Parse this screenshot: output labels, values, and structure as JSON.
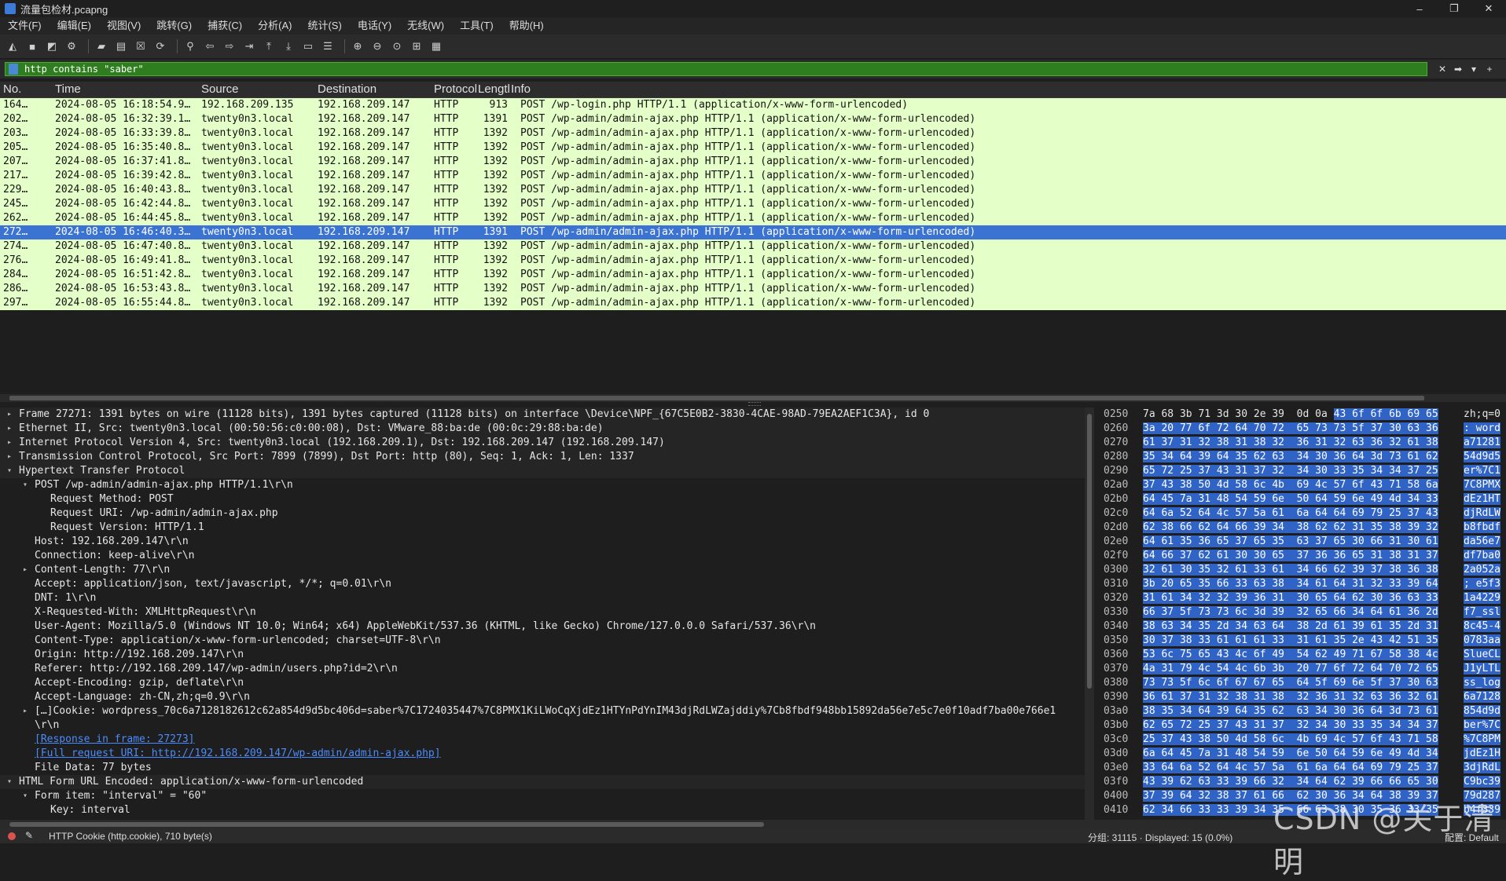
{
  "window": {
    "title": "流量包检材.pcapng",
    "minimize": "–",
    "restore": "❐",
    "close": "✕"
  },
  "menu": [
    "文件(F)",
    "编辑(E)",
    "视图(V)",
    "跳转(G)",
    "捕获(C)",
    "分析(A)",
    "统计(S)",
    "电话(Y)",
    "无线(W)",
    "工具(T)",
    "帮助(H)"
  ],
  "toolbar_icons": [
    "shark-fin-start-icon",
    "stop-icon",
    "restart-icon",
    "options-gear-icon",
    "open-folder-icon",
    "save-file-icon",
    "close-file-icon",
    "reload-icon",
    "find-icon",
    "back-arrow-icon",
    "forward-arrow-icon",
    "go-to-packet-icon",
    "first-packet-icon",
    "last-packet-icon",
    "auto-scroll-icon",
    "colorize-icon",
    "zoom-in-icon",
    "zoom-out-icon",
    "normal-size-icon",
    "resize-columns-icon",
    "layout-icon"
  ],
  "filter": {
    "value": "http contains \"saber\"",
    "clear_icon": "✕",
    "apply_icon": "➡",
    "dropdown_icon": "▾",
    "add_icon": "+"
  },
  "packet_list": {
    "columns": [
      "No.",
      "Time",
      "Source",
      "Destination",
      "Protocol",
      "Length",
      "Info"
    ],
    "rows": [
      [
        "164…",
        "2024-08-05 16:18:54.9…",
        "192.168.209.135",
        "192.168.209.147",
        "HTTP",
        "913",
        "POST /wp-login.php HTTP/1.1  (application/x-www-form-urlencoded)"
      ],
      [
        "202…",
        "2024-08-05 16:32:39.1…",
        "twenty0n3.local",
        "192.168.209.147",
        "HTTP",
        "1391",
        "POST /wp-admin/admin-ajax.php HTTP/1.1  (application/x-www-form-urlencoded)"
      ],
      [
        "203…",
        "2024-08-05 16:33:39.8…",
        "twenty0n3.local",
        "192.168.209.147",
        "HTTP",
        "1392",
        "POST /wp-admin/admin-ajax.php HTTP/1.1  (application/x-www-form-urlencoded)"
      ],
      [
        "205…",
        "2024-08-05 16:35:40.8…",
        "twenty0n3.local",
        "192.168.209.147",
        "HTTP",
        "1392",
        "POST /wp-admin/admin-ajax.php HTTP/1.1  (application/x-www-form-urlencoded)"
      ],
      [
        "207…",
        "2024-08-05 16:37:41.8…",
        "twenty0n3.local",
        "192.168.209.147",
        "HTTP",
        "1392",
        "POST /wp-admin/admin-ajax.php HTTP/1.1  (application/x-www-form-urlencoded)"
      ],
      [
        "217…",
        "2024-08-05 16:39:42.8…",
        "twenty0n3.local",
        "192.168.209.147",
        "HTTP",
        "1392",
        "POST /wp-admin/admin-ajax.php HTTP/1.1  (application/x-www-form-urlencoded)"
      ],
      [
        "229…",
        "2024-08-05 16:40:43.8…",
        "twenty0n3.local",
        "192.168.209.147",
        "HTTP",
        "1392",
        "POST /wp-admin/admin-ajax.php HTTP/1.1  (application/x-www-form-urlencoded)"
      ],
      [
        "245…",
        "2024-08-05 16:42:44.8…",
        "twenty0n3.local",
        "192.168.209.147",
        "HTTP",
        "1392",
        "POST /wp-admin/admin-ajax.php HTTP/1.1  (application/x-www-form-urlencoded)"
      ],
      [
        "262…",
        "2024-08-05 16:44:45.8…",
        "twenty0n3.local",
        "192.168.209.147",
        "HTTP",
        "1392",
        "POST /wp-admin/admin-ajax.php HTTP/1.1  (application/x-www-form-urlencoded)"
      ],
      [
        "272…",
        "2024-08-05 16:46:40.3…",
        "twenty0n3.local",
        "192.168.209.147",
        "HTTP",
        "1391",
        "POST /wp-admin/admin-ajax.php HTTP/1.1  (application/x-www-form-urlencoded)"
      ],
      [
        "274…",
        "2024-08-05 16:47:40.8…",
        "twenty0n3.local",
        "192.168.209.147",
        "HTTP",
        "1392",
        "POST /wp-admin/admin-ajax.php HTTP/1.1  (application/x-www-form-urlencoded)"
      ],
      [
        "276…",
        "2024-08-05 16:49:41.8…",
        "twenty0n3.local",
        "192.168.209.147",
        "HTTP",
        "1392",
        "POST /wp-admin/admin-ajax.php HTTP/1.1  (application/x-www-form-urlencoded)"
      ],
      [
        "284…",
        "2024-08-05 16:51:42.8…",
        "twenty0n3.local",
        "192.168.209.147",
        "HTTP",
        "1392",
        "POST /wp-admin/admin-ajax.php HTTP/1.1  (application/x-www-form-urlencoded)"
      ],
      [
        "286…",
        "2024-08-05 16:53:43.8…",
        "twenty0n3.local",
        "192.168.209.147",
        "HTTP",
        "1392",
        "POST /wp-admin/admin-ajax.php HTTP/1.1  (application/x-www-form-urlencoded)"
      ],
      [
        "297…",
        "2024-08-05 16:55:44.8…",
        "twenty0n3.local",
        "192.168.209.147",
        "HTTP",
        "1392",
        "POST /wp-admin/admin-ajax.php HTTP/1.1  (application/x-www-form-urlencoded)"
      ]
    ],
    "selected_row": 9,
    "colors": {
      "row_bg": "#e4ffc7",
      "selected_bg": "#3b73d3"
    }
  },
  "details": [
    {
      "indent": 0,
      "arrow": "▸",
      "text": "Frame 27271: 1391 bytes on wire (11128 bits), 1391 bytes captured (11128 bits) on interface \\Device\\NPF_{67C5E0B2-3830-4CAE-98AD-79EA2AEF1C3A}, id 0"
    },
    {
      "indent": 0,
      "arrow": "▸",
      "text": "Ethernet II, Src: twenty0n3.local (00:50:56:c0:00:08), Dst: VMware_88:ba:de (00:0c:29:88:ba:de)"
    },
    {
      "indent": 0,
      "arrow": "▸",
      "text": "Internet Protocol Version 4, Src: twenty0n3.local (192.168.209.1), Dst: 192.168.209.147 (192.168.209.147)"
    },
    {
      "indent": 0,
      "arrow": "▸",
      "text": "Transmission Control Protocol, Src Port: 7899 (7899), Dst Port: http (80), Seq: 1, Ack: 1, Len: 1337"
    },
    {
      "indent": 0,
      "arrow": "▾",
      "text": "Hypertext Transfer Protocol"
    },
    {
      "indent": 1,
      "arrow": "▾",
      "text": "POST /wp-admin/admin-ajax.php HTTP/1.1\\r\\n"
    },
    {
      "indent": 2,
      "arrow": "",
      "text": "Request Method: POST"
    },
    {
      "indent": 2,
      "arrow": "",
      "text": "Request URI: /wp-admin/admin-ajax.php"
    },
    {
      "indent": 2,
      "arrow": "",
      "text": "Request Version: HTTP/1.1"
    },
    {
      "indent": 1,
      "arrow": "",
      "text": "Host: 192.168.209.147\\r\\n"
    },
    {
      "indent": 1,
      "arrow": "",
      "text": "Connection: keep-alive\\r\\n"
    },
    {
      "indent": 1,
      "arrow": "▸",
      "text": "Content-Length: 77\\r\\n"
    },
    {
      "indent": 1,
      "arrow": "",
      "text": "Accept: application/json, text/javascript, */*; q=0.01\\r\\n"
    },
    {
      "indent": 1,
      "arrow": "",
      "text": "DNT: 1\\r\\n"
    },
    {
      "indent": 1,
      "arrow": "",
      "text": "X-Requested-With: XMLHttpRequest\\r\\n"
    },
    {
      "indent": 1,
      "arrow": "",
      "text": "User-Agent: Mozilla/5.0 (Windows NT 10.0; Win64; x64) AppleWebKit/537.36 (KHTML, like Gecko) Chrome/127.0.0.0 Safari/537.36\\r\\n"
    },
    {
      "indent": 1,
      "arrow": "",
      "text": "Content-Type: application/x-www-form-urlencoded; charset=UTF-8\\r\\n"
    },
    {
      "indent": 1,
      "arrow": "",
      "text": "Origin: http://192.168.209.147\\r\\n"
    },
    {
      "indent": 1,
      "arrow": "",
      "text": "Referer: http://192.168.209.147/wp-admin/users.php?id=2\\r\\n"
    },
    {
      "indent": 1,
      "arrow": "",
      "text": "Accept-Encoding: gzip, deflate\\r\\n"
    },
    {
      "indent": 1,
      "arrow": "",
      "text": "Accept-Language: zh-CN,zh;q=0.9\\r\\n"
    },
    {
      "indent": 1,
      "arrow": "▸",
      "text": " […]Cookie: wordpress_70c6a7128182612c62a854d9d5bc406d=saber%7C1724035447%7C8PMX1KiLWoCqXjdEz1HTYnPdYnIM43djRdLWZajddiy%7Cb8fbdf948bb15892da56e7e5c7e0f10adf7ba00e766e1"
    },
    {
      "indent": 1,
      "arrow": "",
      "text": "\\r\\n"
    },
    {
      "indent": 1,
      "arrow": "",
      "text": "[Response in frame: 27273]",
      "link": true
    },
    {
      "indent": 1,
      "arrow": "",
      "text": "[Full request URI: http://192.168.209.147/wp-admin/admin-ajax.php]",
      "link": true
    },
    {
      "indent": 1,
      "arrow": "",
      "text": "File Data: 77 bytes"
    },
    {
      "indent": 0,
      "arrow": "▾",
      "text": "HTML Form URL Encoded: application/x-www-form-urlencoded"
    },
    {
      "indent": 1,
      "arrow": "▾",
      "text": "Form item: \"interval\" = \"60\""
    },
    {
      "indent": 2,
      "arrow": "",
      "text": "Key: interval"
    }
  ],
  "hex": [
    {
      "off": "0250",
      "hex_plain": "7a 68 3b 71 3d 30 2e 39  0d 0a ",
      "hex_hl": "43 6f 6f 6b 69 65",
      "ascii_plain": "zh;q=0",
      "ascii_hl": ""
    },
    {
      "off": "0260",
      "hex_plain": "",
      "hex_hl": "3a 20 77 6f 72 64 70 72  65 73 73 5f 37 30 63 36",
      "ascii_plain": "",
      "ascii_hl": ": word"
    },
    {
      "off": "0270",
      "hex_plain": "",
      "hex_hl": "61 37 31 32 38 31 38 32  36 31 32 63 36 32 61 38",
      "ascii_plain": "",
      "ascii_hl": "a71281"
    },
    {
      "off": "0280",
      "hex_plain": "",
      "hex_hl": "35 34 64 39 64 35 62 63  34 30 36 64 3d 73 61 62",
      "ascii_plain": "",
      "ascii_hl": "54d9d5"
    },
    {
      "off": "0290",
      "hex_plain": "",
      "hex_hl": "65 72 25 37 43 31 37 32  34 30 33 35 34 34 37 25",
      "ascii_plain": "",
      "ascii_hl": "er%7C1"
    },
    {
      "off": "02a0",
      "hex_plain": "",
      "hex_hl": "37 43 38 50 4d 58 6c 4b  69 4c 57 6f 43 71 58 6a",
      "ascii_plain": "",
      "ascii_hl": "7C8PMX"
    },
    {
      "off": "02b0",
      "hex_plain": "",
      "hex_hl": "64 45 7a 31 48 54 59 6e  50 64 59 6e 49 4d 34 33",
      "ascii_plain": "",
      "ascii_hl": "dEz1HT"
    },
    {
      "off": "02c0",
      "hex_plain": "",
      "hex_hl": "64 6a 52 64 4c 57 5a 61  6a 64 64 69 79 25 37 43",
      "ascii_plain": "",
      "ascii_hl": "djRdLW"
    },
    {
      "off": "02d0",
      "hex_plain": "",
      "hex_hl": "62 38 66 62 64 66 39 34  38 62 62 31 35 38 39 32",
      "ascii_plain": "",
      "ascii_hl": "b8fbdf"
    },
    {
      "off": "02e0",
      "hex_plain": "",
      "hex_hl": "64 61 35 36 65 37 65 35  63 37 65 30 66 31 30 61",
      "ascii_plain": "",
      "ascii_hl": "da56e7"
    },
    {
      "off": "02f0",
      "hex_plain": "",
      "hex_hl": "64 66 37 62 61 30 30 65  37 36 36 65 31 38 31 37",
      "ascii_plain": "",
      "ascii_hl": "df7ba0"
    },
    {
      "off": "0300",
      "hex_plain": "",
      "hex_hl": "32 61 30 35 32 61 33 61  34 66 62 39 37 38 36 38",
      "ascii_plain": "",
      "ascii_hl": "2a052a"
    },
    {
      "off": "0310",
      "hex_plain": "",
      "hex_hl": "3b 20 65 35 66 33 63 38  34 61 64 31 32 33 39 64",
      "ascii_plain": "",
      "ascii_hl": "; e5f3"
    },
    {
      "off": "0320",
      "hex_plain": "",
      "hex_hl": "31 61 34 32 32 39 36 31  30 65 64 62 30 36 63 33",
      "ascii_plain": "",
      "ascii_hl": "1a4229"
    },
    {
      "off": "0330",
      "hex_plain": "",
      "hex_hl": "66 37 5f 73 73 6c 3d 39  32 65 66 34 64 61 36 2d",
      "ascii_plain": "",
      "ascii_hl": "f7_ssl"
    },
    {
      "off": "0340",
      "hex_plain": "",
      "hex_hl": "38 63 34 35 2d 34 63 64  38 2d 61 39 61 35 2d 31",
      "ascii_plain": "",
      "ascii_hl": "8c45-4"
    },
    {
      "off": "0350",
      "hex_plain": "",
      "hex_hl": "30 37 38 33 61 61 61 33  31 61 35 2e 43 42 51 35",
      "ascii_plain": "",
      "ascii_hl": "0783aa"
    },
    {
      "off": "0360",
      "hex_plain": "",
      "hex_hl": "53 6c 75 65 43 4c 6f 49  54 62 49 71 67 58 38 4c",
      "ascii_plain": "",
      "ascii_hl": "SlueCL"
    },
    {
      "off": "0370",
      "hex_plain": "",
      "hex_hl": "4a 31 79 4c 54 4c 6b 3b  20 77 6f 72 64 70 72 65",
      "ascii_plain": "",
      "ascii_hl": "J1yLTL"
    },
    {
      "off": "0380",
      "hex_plain": "",
      "hex_hl": "73 73 5f 6c 6f 67 67 65  64 5f 69 6e 5f 37 30 63",
      "ascii_plain": "",
      "ascii_hl": "ss_log"
    },
    {
      "off": "0390",
      "hex_plain": "",
      "hex_hl": "36 61 37 31 32 38 31 38  32 36 31 32 63 36 32 61",
      "ascii_plain": "",
      "ascii_hl": "6a7128"
    },
    {
      "off": "03a0",
      "hex_plain": "",
      "hex_hl": "38 35 34 64 39 64 35 62  63 34 30 36 64 3d 73 61",
      "ascii_plain": "",
      "ascii_hl": "854d9d"
    },
    {
      "off": "03b0",
      "hex_plain": "",
      "hex_hl": "62 65 72 25 37 43 31 37  32 34 30 33 35 34 34 37",
      "ascii_plain": "",
      "ascii_hl": "ber%7C"
    },
    {
      "off": "03c0",
      "hex_plain": "",
      "hex_hl": "25 37 43 38 50 4d 58 6c  4b 69 4c 57 6f 43 71 58",
      "ascii_plain": "",
      "ascii_hl": "%7C8PM"
    },
    {
      "off": "03d0",
      "hex_plain": "",
      "hex_hl": "6a 64 45 7a 31 48 54 59  6e 50 64 59 6e 49 4d 34",
      "ascii_plain": "",
      "ascii_hl": "jdEz1H"
    },
    {
      "off": "03e0",
      "hex_plain": "",
      "hex_hl": "33 64 6a 52 64 4c 57 5a  61 6a 64 64 69 79 25 37",
      "ascii_plain": "",
      "ascii_hl": "3djRdL"
    },
    {
      "off": "03f0",
      "hex_plain": "",
      "hex_hl": "43 39 62 63 33 39 66 32  34 64 62 39 66 66 65 30",
      "ascii_plain": "",
      "ascii_hl": "C9bc39"
    },
    {
      "off": "0400",
      "hex_plain": "",
      "hex_hl": "37 39 64 32 38 37 61 66  62 30 36 34 64 38 39 37",
      "ascii_plain": "",
      "ascii_hl": "79d287"
    },
    {
      "off": "0410",
      "hex_plain": "",
      "hex_hl": "62 34 66 33 33 39 34 35  66 63 38 30 35 36 33 35",
      "ascii_plain": "",
      "ascii_hl": "b4f339"
    }
  ],
  "status": {
    "left": "HTTP Cookie (http.cookie), 710 byte(s)",
    "mid": "分组: 31115 · Displayed: 15 (0.0%)",
    "right": "配置: Default"
  },
  "watermark": "CSDN @关于清明"
}
